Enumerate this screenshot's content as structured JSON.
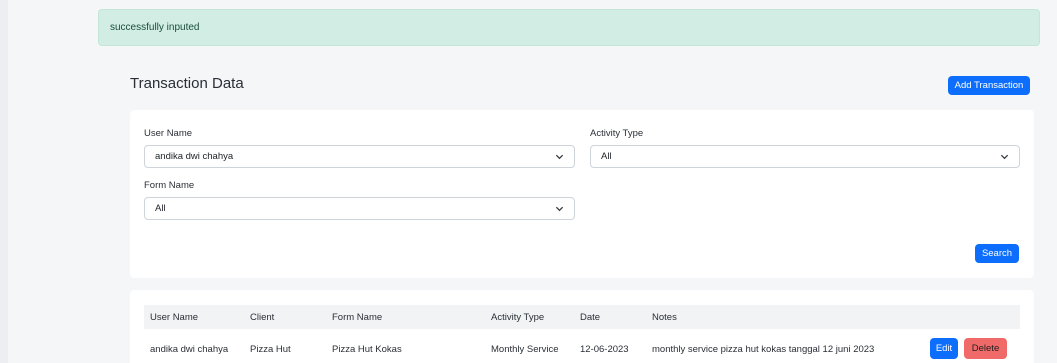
{
  "alert": {
    "message": "successfully inputed"
  },
  "header": {
    "title": "Transaction Data",
    "add_button": "Add Transaction"
  },
  "filters": {
    "user_name": {
      "label": "User Name",
      "value": "andika dwi chahya"
    },
    "activity_type": {
      "label": "Activity Type",
      "value": "All"
    },
    "form_name": {
      "label": "Form Name",
      "value": "All"
    },
    "search_button": "Search"
  },
  "table": {
    "columns": [
      "User Name",
      "Client",
      "Form Name",
      "Activity Type",
      "Date",
      "Notes"
    ],
    "rows": [
      {
        "user_name": "andika dwi chahya",
        "client": "Pizza Hut",
        "form_name": "Pizza Hut Kokas",
        "activity_type": "Monthly Service",
        "date": "12-06-2023",
        "notes": "monthly service pizza hut kokas tanggal 12 juni 2023",
        "edit_label": "Edit",
        "delete_label": "Delete"
      }
    ]
  },
  "icons": [
    "chevron-down-icon"
  ],
  "colors": {
    "primary": "#0d6efd",
    "danger": "#f06a6a",
    "alert_bg": "#d1ede4",
    "page_bg": "#f4f6f8"
  }
}
